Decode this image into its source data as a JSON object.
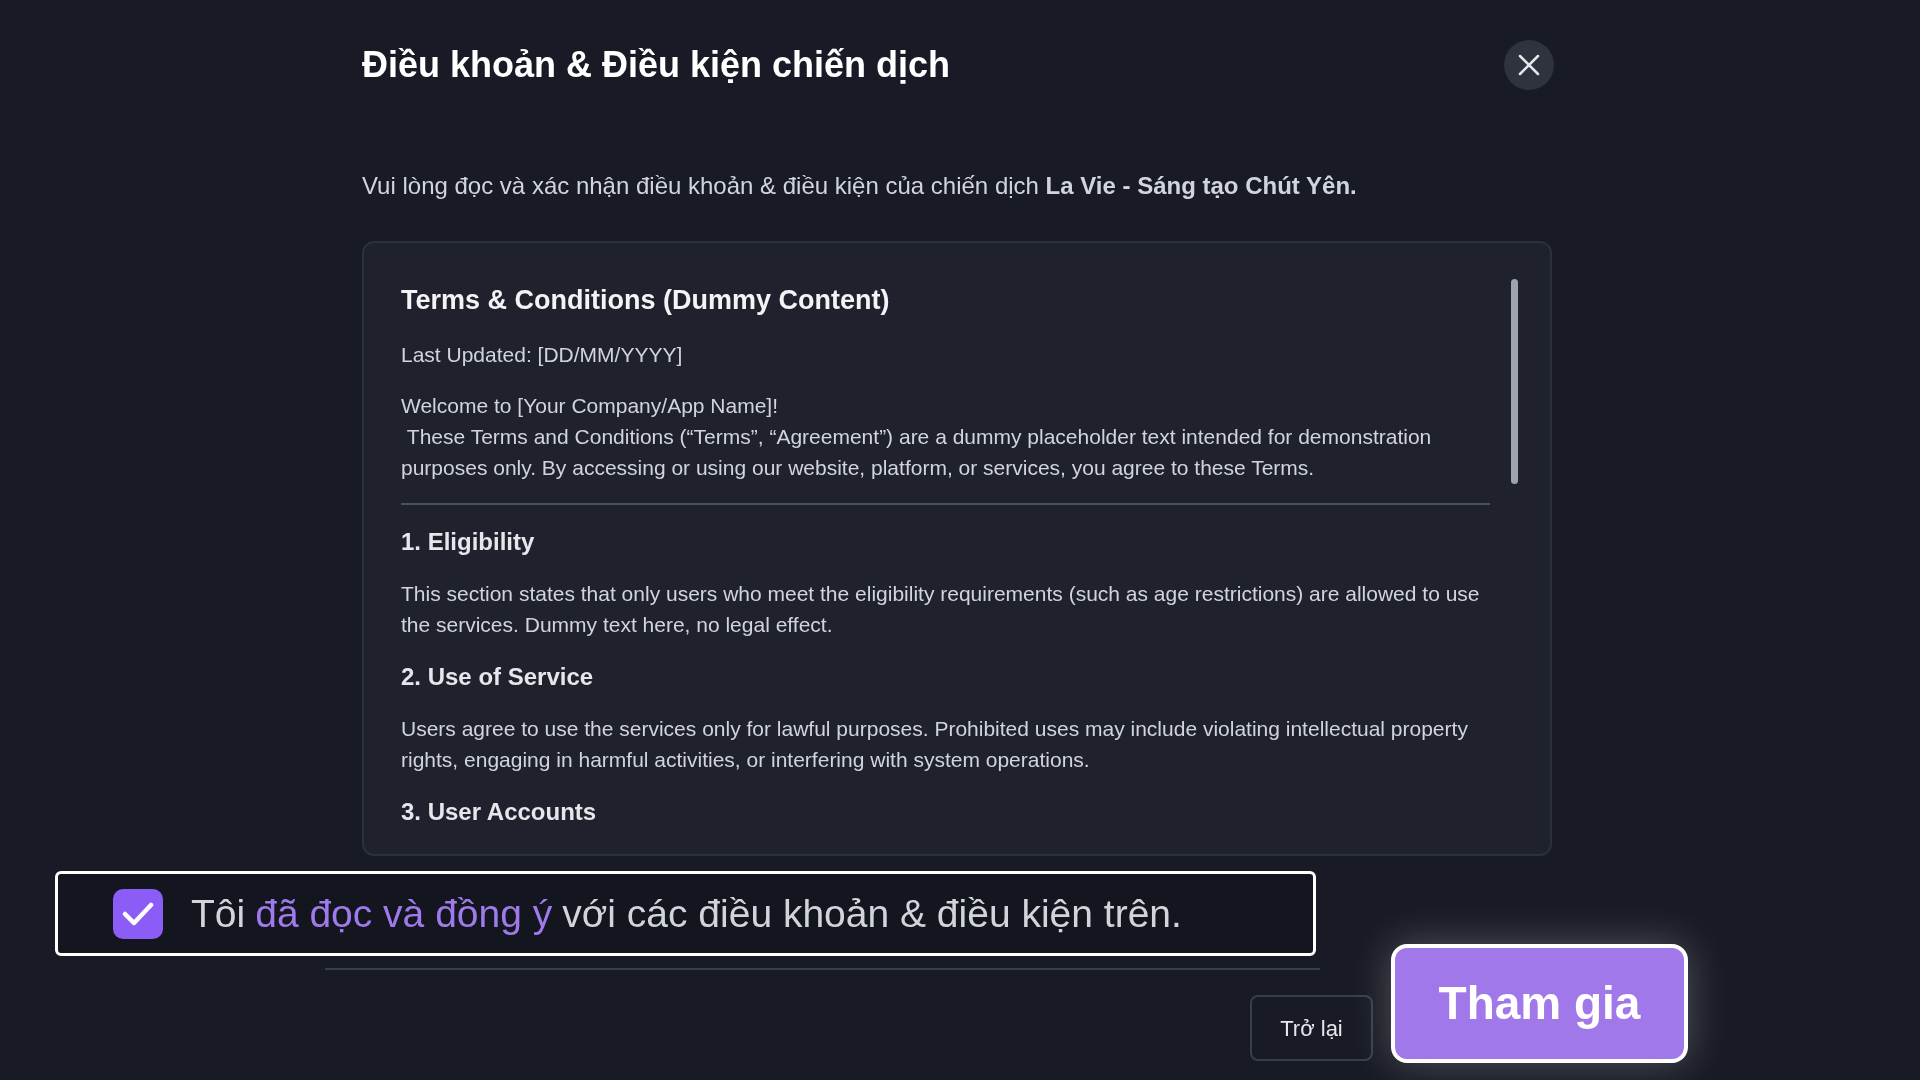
{
  "dialog": {
    "title": "Điều khoản & Điều kiện chiến dịch",
    "intro": "Vui lòng đọc và xác nhận điều khoản & điều kiện của chiến dịch **La Vie - Sáng tạo Chút Yên.**",
    "terms": [
      {
        "kind": "title",
        "text": "Terms & Conditions (Dummy Content)"
      },
      {
        "kind": "meta",
        "text": "Last Updated: [DD/MM/YYYY]"
      },
      {
        "kind": "paragraph",
        "text": "Welcome to [Your Company/App Name]!\n These Terms and Conditions (“Terms”, “Agreement”) are a dummy placeholder text intended for demonstration purposes only. By accessing or using our website, platform, or services, you agree to these Terms."
      },
      {
        "kind": "divider"
      },
      {
        "kind": "heading",
        "text": "1. Eligibility"
      },
      {
        "kind": "paragraph",
        "text": "This section states that only users who meet the eligibility requirements (such as age restrictions) are allowed to use the services. Dummy text here, no legal effect."
      },
      {
        "kind": "heading",
        "text": "2. Use of Service"
      },
      {
        "kind": "paragraph",
        "text": "Users agree to use the services only for lawful purposes. Prohibited uses may include violating intellectual property rights, engaging in harmful activities, or interfering with system operations."
      },
      {
        "kind": "heading",
        "text": "3. User Accounts"
      }
    ],
    "agreement": {
      "checked": true,
      "prefix": "Tôi",
      "link": "đã đọc và đồng ý",
      "suffix": "với các điều khoản & điều kiện trên."
    },
    "buttons": [
      {
        "kind": "secondary",
        "label": "Trở lại"
      },
      {
        "kind": "primary",
        "label": "Tham gia"
      }
    ]
  }
}
